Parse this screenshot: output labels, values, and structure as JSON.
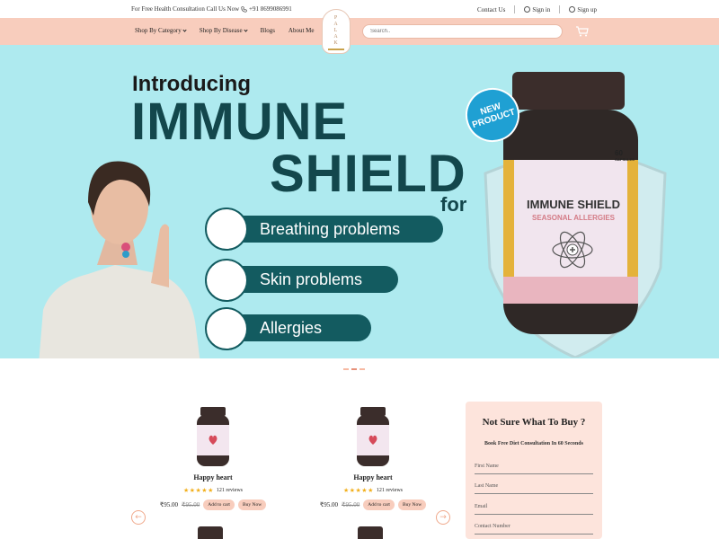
{
  "topbar": {
    "promo": "For Free Health Consultation Call Us Now",
    "phone": "+91 8699086991",
    "contact_label": "Contact Us",
    "signin_label": "Sign in",
    "signup_label": "Sign up"
  },
  "nav": {
    "items": [
      {
        "label": "Shop By Category",
        "has_dropdown": true
      },
      {
        "label": "Shop By Disease",
        "has_dropdown": true
      },
      {
        "label": "Blogs",
        "has_dropdown": false
      },
      {
        "label": "About Me",
        "has_dropdown": false
      }
    ],
    "logo_letters": [
      "P",
      "A",
      "L",
      "A",
      "K"
    ],
    "search_placeholder": "Search..",
    "cart_icon": "cart-icon"
  },
  "hero": {
    "intro": "Introducing",
    "title_line1": "IMMUNE",
    "title_line2": "SHIELD",
    "for_word": "for",
    "benefits": [
      "Breathing problems",
      "Skin problems",
      "Allergies"
    ],
    "badge_line1": "NEW",
    "badge_line2": "PRODUCT",
    "bottle_name": "IMMUNE SHIELD",
    "bottle_sub": "SEASONAL ALLERGIES",
    "bottle_count": "60",
    "bottle_count_unit": "CAPSULES"
  },
  "products": [
    {
      "name": "Happy heart",
      "stars": "★★★★★",
      "reviews": "121 reviews",
      "price": "₹95.00",
      "old_price": "₹95.00",
      "add_label": "Add to cart",
      "buy_label": "Buy Now"
    },
    {
      "name": "Happy heart",
      "stars": "★★★★★",
      "reviews": "121 reviews",
      "price": "₹95.00",
      "old_price": "₹95.00",
      "add_label": "Add to cart",
      "buy_label": "Buy Now"
    }
  ],
  "consult": {
    "title": "Not Sure What To Buy ?",
    "subtitle": "Book Free Diet Consultation In 60 Seconds",
    "fields": [
      "First Name",
      "Last Name",
      "Email",
      "Contact Number"
    ]
  },
  "colors": {
    "nav_bg": "#f8cdbd",
    "hero_bg": "#aeeaef",
    "hero_teal": "#13474c",
    "pill_teal": "#135b60",
    "badge_blue": "#1fa0d3",
    "consult_bg": "#fde4dc",
    "star": "#f2b01e"
  }
}
